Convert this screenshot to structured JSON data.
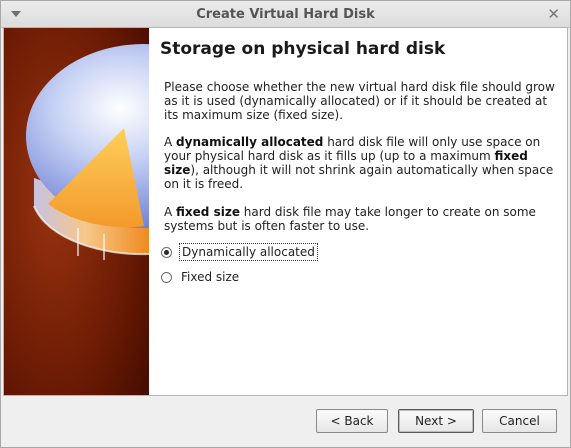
{
  "window": {
    "title": "Create Virtual Hard Disk",
    "close_glyph": "✕"
  },
  "page": {
    "title": "Storage on physical hard disk",
    "p1": "Please choose whether the new virtual hard disk file should grow as it is used (dynamically allocated) or if it should be created at its maximum size (fixed size).",
    "p2_a": "A ",
    "p2_bold1": "dynamically allocated",
    "p2_b": " hard disk file will only use space on your physical hard disk as it fills up (up to a maximum ",
    "p2_bold2": "fixed size",
    "p2_c": "), although it will not shrink again automatically when space on it is freed.",
    "p3_a": "A ",
    "p3_bold": "fixed size",
    "p3_b": " hard disk file may take longer to create on some systems but is often faster to use."
  },
  "options": [
    {
      "label": "Dynamically allocated",
      "selected": true
    },
    {
      "label": "Fixed size",
      "selected": false
    }
  ],
  "buttons": {
    "back": "< Back",
    "next": "Next >",
    "cancel": "Cancel"
  },
  "colors": {
    "banner_dark": "#4a0c00",
    "banner_mid": "#8a2a0a",
    "disk_blue": "#7f95e0",
    "disk_orange": "#f4a030"
  }
}
